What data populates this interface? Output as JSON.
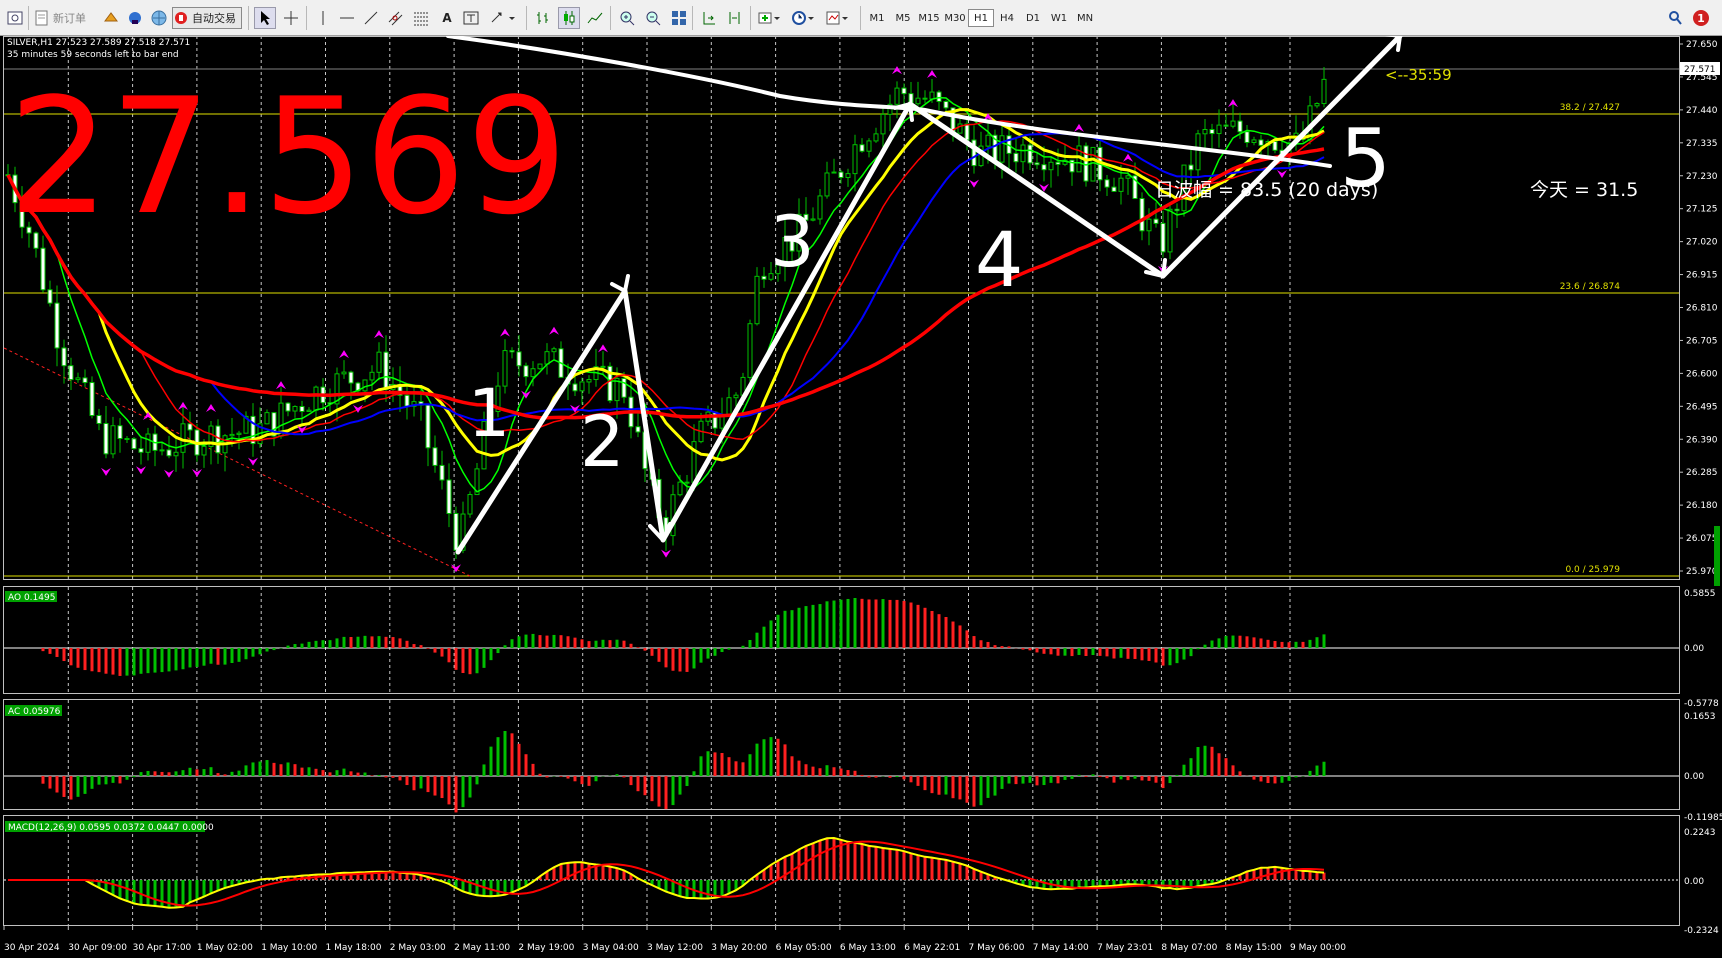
{
  "toolbar": {
    "new_order": "新订单",
    "auto_trading": "自动交易",
    "timeframes": [
      "M1",
      "M5",
      "M15",
      "M30",
      "H1",
      "H4",
      "D1",
      "W1",
      "MN"
    ],
    "active_timeframe": "H1",
    "notification_count": "1"
  },
  "chart": {
    "info_line": "SILVER,H1  27.523 27.589 27.518 27.571",
    "bar_timer": "35 minutes 59 seconds left to bar end",
    "big_price": "27.569",
    "countdown": "<--35:59",
    "daily_range": "日波幅 = 83.5 (20 days)",
    "today": "今天 = 31.5",
    "wave_labels": [
      "1",
      "2",
      "3",
      "4",
      "5"
    ],
    "current_price": "27.571",
    "price_axis": [
      "27.650",
      "27.545",
      "27.440",
      "27.335",
      "27.230",
      "27.125",
      "27.020",
      "26.915",
      "26.810",
      "26.705",
      "26.600",
      "26.495",
      "26.390",
      "26.285",
      "26.180",
      "26.075",
      "25.970"
    ],
    "fib_levels": [
      {
        "label": "38.2  /  27.427",
        "price": 27.427
      },
      {
        "label": "23.6  /  26.874",
        "price": 26.874
      },
      {
        "label": "0.0  /  25.979",
        "price": 25.979
      }
    ],
    "time_axis": [
      "30 Apr 2024",
      "30 Apr 09:00",
      "30 Apr 17:00",
      "1 May 02:00",
      "1 May 10:00",
      "1 May 18:00",
      "2 May 03:00",
      "2 May 11:00",
      "2 May 19:00",
      "3 May 04:00",
      "3 May 12:00",
      "3 May 20:00",
      "6 May 05:00",
      "6 May 13:00",
      "6 May 22:01",
      "7 May 06:00",
      "7 May 14:00",
      "7 May 23:01",
      "8 May 07:00",
      "8 May 15:00",
      "9 May 00:00"
    ]
  },
  "indicators": {
    "ao": {
      "label": "AO 0.1495",
      "axis": [
        "0.5855",
        "0.00",
        "-0.5778"
      ]
    },
    "ac": {
      "label": "AC 0.05976",
      "axis": [
        "0.1653",
        "0.00",
        "-0.11985"
      ]
    },
    "macd": {
      "label": "MACD(12,26,9) 0.0595 0.0372 0.0447 0.0000",
      "axis": [
        "0.2243",
        "0.00",
        "-0.2324"
      ]
    }
  },
  "colors": {
    "bull": "#00c000",
    "bear": "#ff2020",
    "ma_yellow": "#ffff00",
    "ma_blue": "#0000ff",
    "ma_red": "#ff0000",
    "ma_green": "#00ff00",
    "fib": "#e0e000",
    "arrow": "#ff00ff",
    "big_price": "#ff0000"
  }
}
